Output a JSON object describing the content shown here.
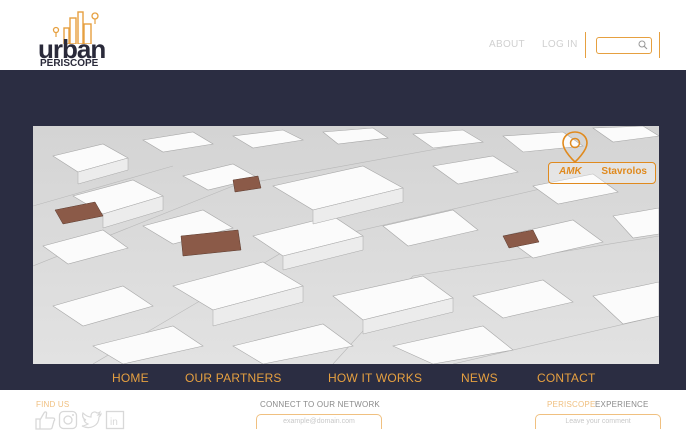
{
  "logo": {
    "word": "urban",
    "sub": "PERISCOPE"
  },
  "topnav": {
    "about": "ABOUT",
    "login": "LOG IN"
  },
  "search": {
    "value": ""
  },
  "hero": {
    "city": "Stavrolos",
    "city_prefix": "AMK"
  },
  "mainnav": {
    "items": [
      "HOME",
      "OUR PARTNERS",
      "HOW IT WORKS",
      "NEWS",
      "CONTACT"
    ]
  },
  "footer": {
    "find_us": "FIND US",
    "network_title": "CONNECT TO OUR NETWORK",
    "email_placeholder": "example@domain.com",
    "experience_prefix": "PERISCOPE",
    "experience_suffix": "EXPERIENCE",
    "comment_placeholder": "Leave your comment"
  },
  "colors": {
    "accent": "#e6a040",
    "banner": "#2b2d42",
    "text_dark": "#2a2a3a"
  },
  "icons": [
    "search-icon",
    "map-pin-icon",
    "like-icon",
    "instagram-icon",
    "twitter-icon",
    "linkedin-icon"
  ]
}
